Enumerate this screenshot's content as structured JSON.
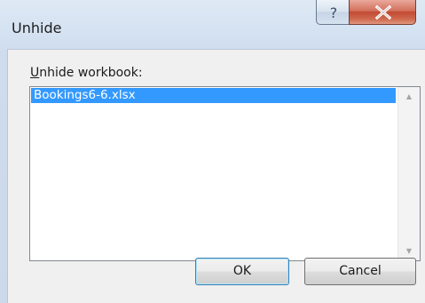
{
  "dialog": {
    "title": "Unhide",
    "help_icon": "help-question-icon",
    "close_icon": "close-x-icon"
  },
  "list": {
    "label_accel": "U",
    "label_rest": "nhide workbook:",
    "items": [
      "Bookings6-6.xlsx"
    ],
    "selected_index": 0
  },
  "buttons": {
    "ok": "OK",
    "cancel": "Cancel"
  },
  "colors": {
    "selection": "#3399ff",
    "close_button": "#c24a34"
  }
}
